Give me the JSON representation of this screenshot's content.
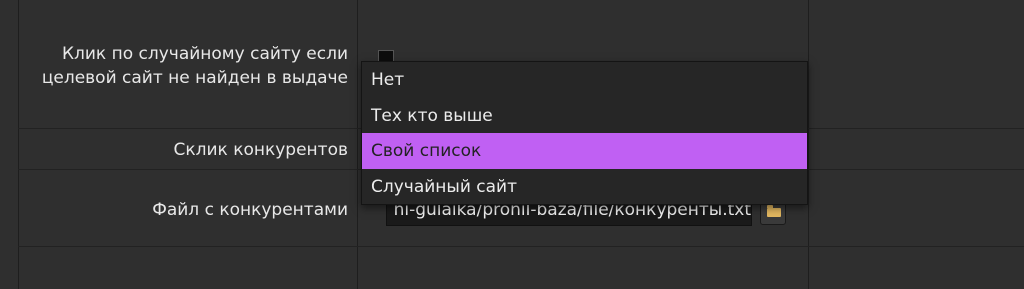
{
  "settings": {
    "random_click_label_line1": "Клик по случайному сайту если",
    "random_click_label_line2": "целевой сайт не найден в выдаче",
    "competitor_click_label": "Склик конкурентов",
    "competitor_file_label": "Файл с конкурентами",
    "competitor_file_value": "ni-gulaika/pronil-baza/file/конкуренты.txt"
  },
  "dropdown": {
    "options": [
      {
        "label": "Нет"
      },
      {
        "label": "Тех кто выше"
      },
      {
        "label": "Свой список"
      },
      {
        "label": "Случайный сайт"
      }
    ],
    "selected_index": 2
  },
  "colors": {
    "background": "#2f2f2f",
    "highlight": "#c060f3",
    "menu_background": "#262626"
  },
  "icons": {
    "folder": "folder-icon"
  }
}
